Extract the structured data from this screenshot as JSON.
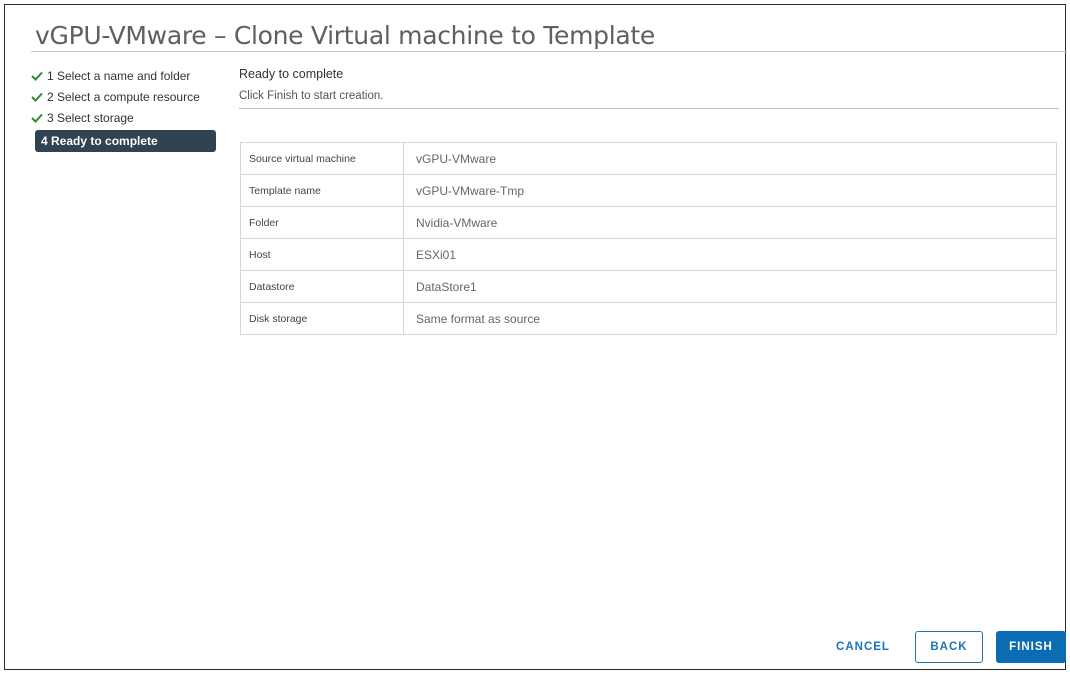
{
  "window": {
    "title": "vGPU-VMware – Clone Virtual machine to Template"
  },
  "steps": [
    {
      "label": "1 Select a name and folder",
      "done": true,
      "icon": "check-icon"
    },
    {
      "label": "2 Select a compute resource",
      "done": true,
      "icon": "check-icon"
    },
    {
      "label": "3 Select storage",
      "done": true,
      "icon": "check-icon"
    },
    {
      "label": "4 Ready to complete",
      "done": false,
      "active": true
    }
  ],
  "content": {
    "heading": "Ready to complete",
    "subheading": "Click Finish to start creation."
  },
  "summary": [
    {
      "key": "Source virtual machine",
      "value": "vGPU-VMware"
    },
    {
      "key": "Template name",
      "value": "vGPU-VMware-Tmp"
    },
    {
      "key": "Folder",
      "value": "Nvidia-VMware"
    },
    {
      "key": "Host",
      "value": "ESXi01"
    },
    {
      "key": "Datastore",
      "value": "DataStore1"
    },
    {
      "key": "Disk storage",
      "value": "Same format as source"
    }
  ],
  "buttons": {
    "cancel": "CANCEL",
    "back": "BACK",
    "finish": "FINISH"
  },
  "colors": {
    "accent": "#0b6cb3",
    "active_step_bg": "#314251",
    "check_green": "#2e8b2e"
  }
}
